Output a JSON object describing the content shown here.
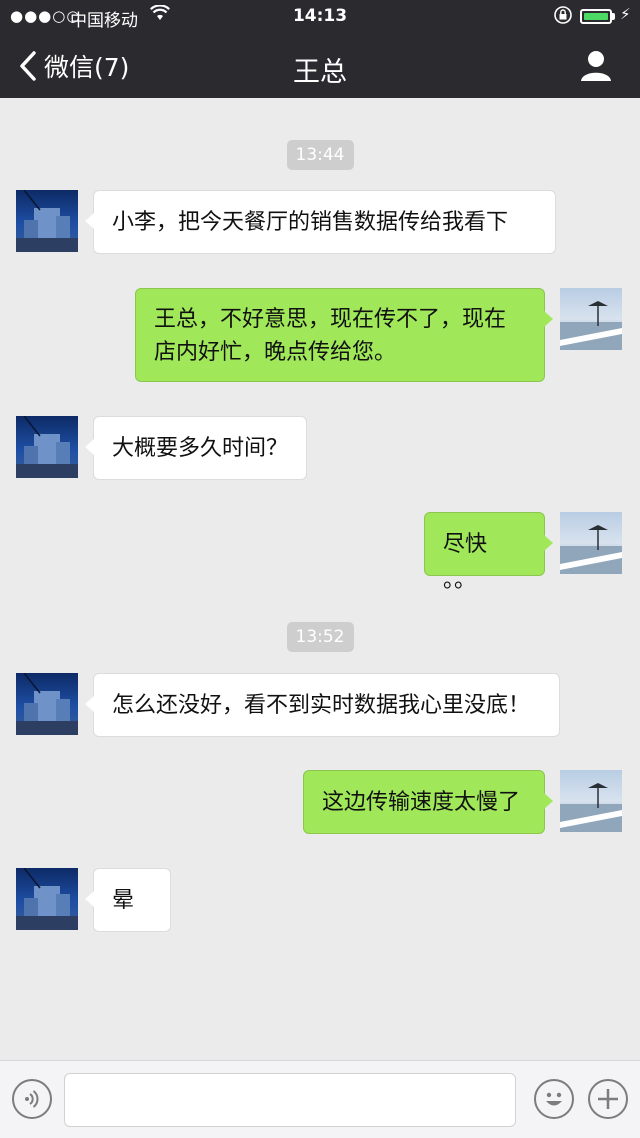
{
  "status": {
    "signal": "●●●○○",
    "carrier": "中国移动",
    "time": "14:13"
  },
  "nav": {
    "back_label": "微信(7)",
    "title": "王总"
  },
  "messages": [
    {
      "type": "time",
      "text": "13:44"
    },
    {
      "type": "in",
      "sender": "王总",
      "text": "小李，把今天餐厅的销售数据传给我看下"
    },
    {
      "type": "out",
      "text": "王总，不好意思，现在传不了，现在店内好忙，晚点传给您。"
    },
    {
      "type": "in",
      "text": "大概要多久时间？"
    },
    {
      "type": "out",
      "text": "尽快 。。"
    },
    {
      "type": "time",
      "text": "13:52"
    },
    {
      "type": "in",
      "text": "怎么还没好，看不到实时数据我心里没底！"
    },
    {
      "type": "out",
      "text": "这边传输速度太慢了"
    },
    {
      "type": "in",
      "text": "晕"
    }
  ],
  "colors": {
    "topbar": "#2b2b2f",
    "outgoing_bubble": "#a0e75a",
    "incoming_bubble": "#ffffff",
    "background": "#ebebeb"
  },
  "icons": {
    "wifi": "wifi-icon",
    "lock": "rotation-lock-icon",
    "battery": "battery-icon",
    "back": "chevron-left-icon",
    "profile": "person-icon",
    "voice": "voice-icon",
    "emoji": "emoji-icon",
    "add": "plus-icon"
  },
  "input": {
    "value": ""
  }
}
